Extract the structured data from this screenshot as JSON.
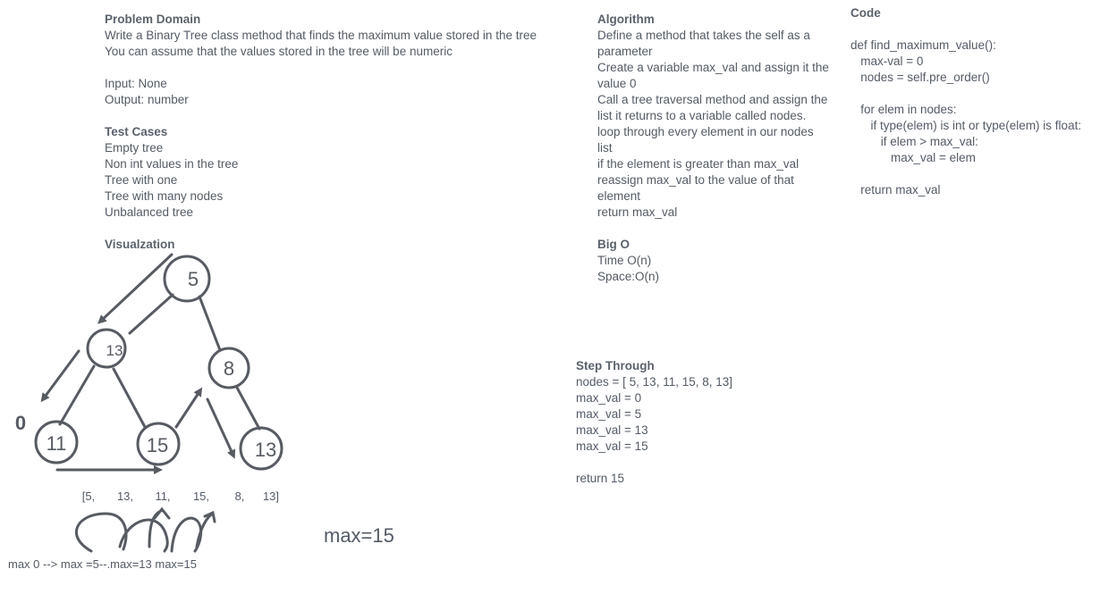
{
  "problem": {
    "heading": "Problem Domain",
    "lines": [
      "Write a Binary Tree class method that finds the maximum value stored in the tree",
      "You can assume that the values stored in the tree will be numeric"
    ],
    "input": "Input: None",
    "output": "Output: number"
  },
  "tests": {
    "heading": "Test Cases",
    "items": [
      "Empty tree",
      "Non int values in the tree",
      "Tree with one",
      "Tree with many nodes",
      "Unbalanced tree"
    ]
  },
  "visualization": {
    "heading": "Visualzation",
    "nodes": [
      "5",
      "13",
      "8",
      "11",
      "15",
      "13"
    ],
    "zero_mark": "0",
    "list_tokens": [
      "[5,",
      "13,",
      "11,",
      "15,",
      "8,",
      "13]"
    ],
    "max_note": "max=15",
    "trace_note": "max 0 --> max =5--.max=13 max=15"
  },
  "algorithm": {
    "heading": "Algorithm",
    "lines": [
      "Define a method that takes the self as a",
      "parameter",
      "Create a variable max_val and assign it the",
      "value 0",
      "Call a tree traversal method and assign the",
      "list it returns to a variable called nodes.",
      "loop through every element in our nodes",
      "list",
      "if the element is greater than max_val",
      "reassign max_val to the value of that",
      "element",
      "return max_val"
    ]
  },
  "bigo": {
    "heading": "Big O",
    "time": "Time O(n)",
    "space": "Space:O(n)"
  },
  "step": {
    "heading": "Step Through",
    "lines": [
      "nodes = [ 5, 13, 11, 15, 8, 13]",
      "max_val = 0",
      "max_val = 5",
      "max_val = 13",
      "max_val = 15"
    ],
    "result": "return 15"
  },
  "code": {
    "heading": "Code",
    "lines": [
      "def find_maximum_value():",
      "   max-val = 0",
      "   nodes = self.pre_order()",
      "",
      "   for elem in nodes:",
      "      if type(elem) is int or type(elem) is float:",
      "         if elem > max_val:",
      "            max_val = elem",
      "",
      "   return max_val"
    ]
  }
}
